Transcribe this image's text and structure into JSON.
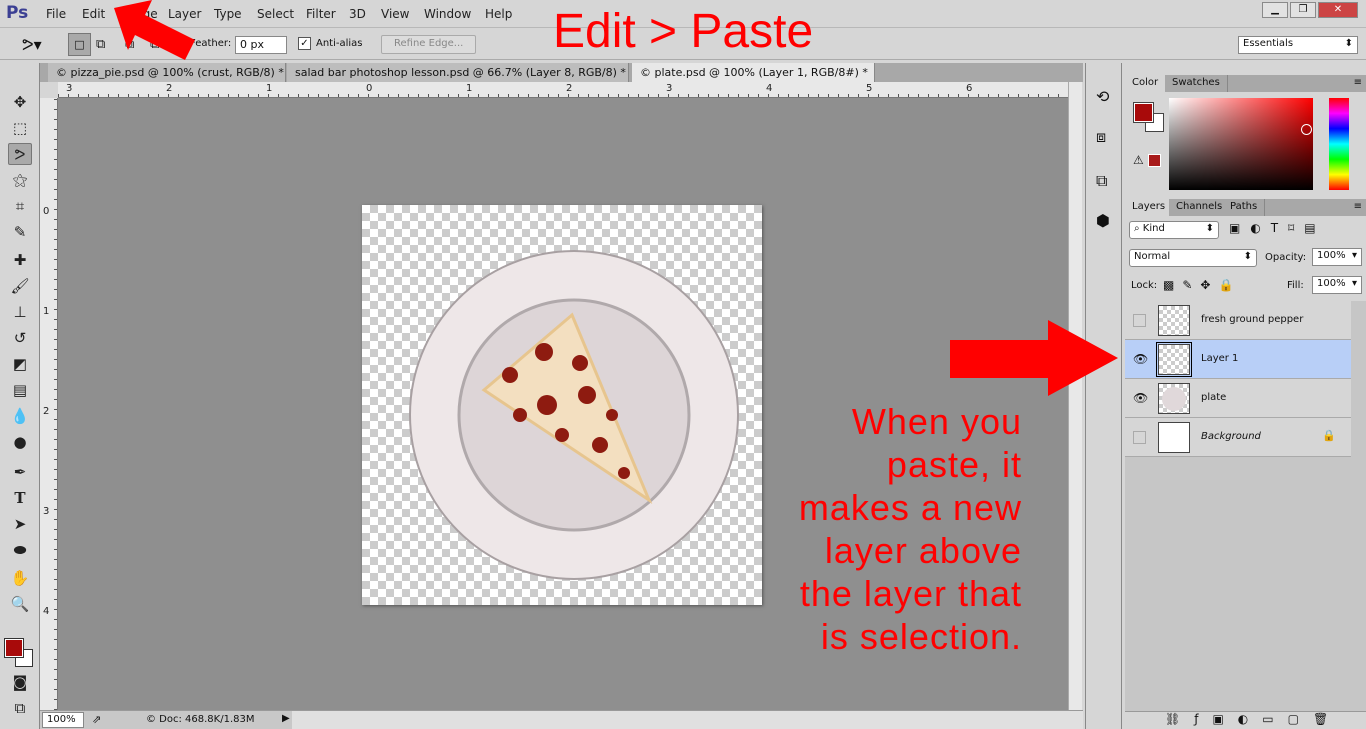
{
  "app": {
    "logo": "Ps",
    "menu": [
      "File",
      "Edit",
      "Image",
      "Layer",
      "Type",
      "Select",
      "Filter",
      "3D",
      "View",
      "Window",
      "Help"
    ],
    "window_controls": [
      "minimize",
      "restore",
      "close"
    ]
  },
  "options": {
    "feather_label": "Feather:",
    "feather_value": "0 px",
    "antialias_label": "Anti-alias",
    "antialias_checked": true,
    "refine_edge": "Refine Edge...",
    "workspace": "Essentials"
  },
  "tabs": [
    {
      "label": "© pizza_pie.psd @ 100% (crust, RGB/8) *",
      "active": false
    },
    {
      "label": "salad bar photoshop lesson.psd @ 66.7% (Layer 8, RGB/8) *",
      "active": false
    },
    {
      "label": "© plate.psd @ 100% (Layer 1, RGB/8#) *",
      "active": true
    }
  ],
  "ruler": {
    "h": [
      "3",
      "2",
      "1",
      "0",
      "1",
      "2",
      "3",
      "4",
      "5",
      "6"
    ],
    "v": [
      "0",
      "1",
      "2",
      "3",
      "4"
    ]
  },
  "status": {
    "zoom": "100%",
    "doc": "© Doc: 468.8K/1.83M"
  },
  "color_panel": {
    "tabs": [
      "Color",
      "Swatches"
    ],
    "foreground": "#a80a0a",
    "background": "#ffffff"
  },
  "layers_panel": {
    "tabs": [
      "Layers",
      "Channels",
      "Paths"
    ],
    "filter": "Kind",
    "blend_mode": "Normal",
    "opacity_label": "Opacity:",
    "opacity": "100%",
    "lock_label": "Lock:",
    "fill_label": "Fill:",
    "fill": "100%",
    "layers": [
      {
        "name": "fresh ground pepper",
        "visible": false,
        "selected": false
      },
      {
        "name": "Layer 1",
        "visible": true,
        "selected": true
      },
      {
        "name": "plate",
        "visible": true,
        "selected": false
      },
      {
        "name": "Background",
        "visible": false,
        "selected": false,
        "locked": true
      }
    ]
  },
  "annotations": {
    "title": "Edit > Paste",
    "note": [
      "When you",
      "paste, it",
      "makes a new",
      "layer above",
      "the layer that",
      "is selection."
    ],
    "color": "#ff0000"
  }
}
